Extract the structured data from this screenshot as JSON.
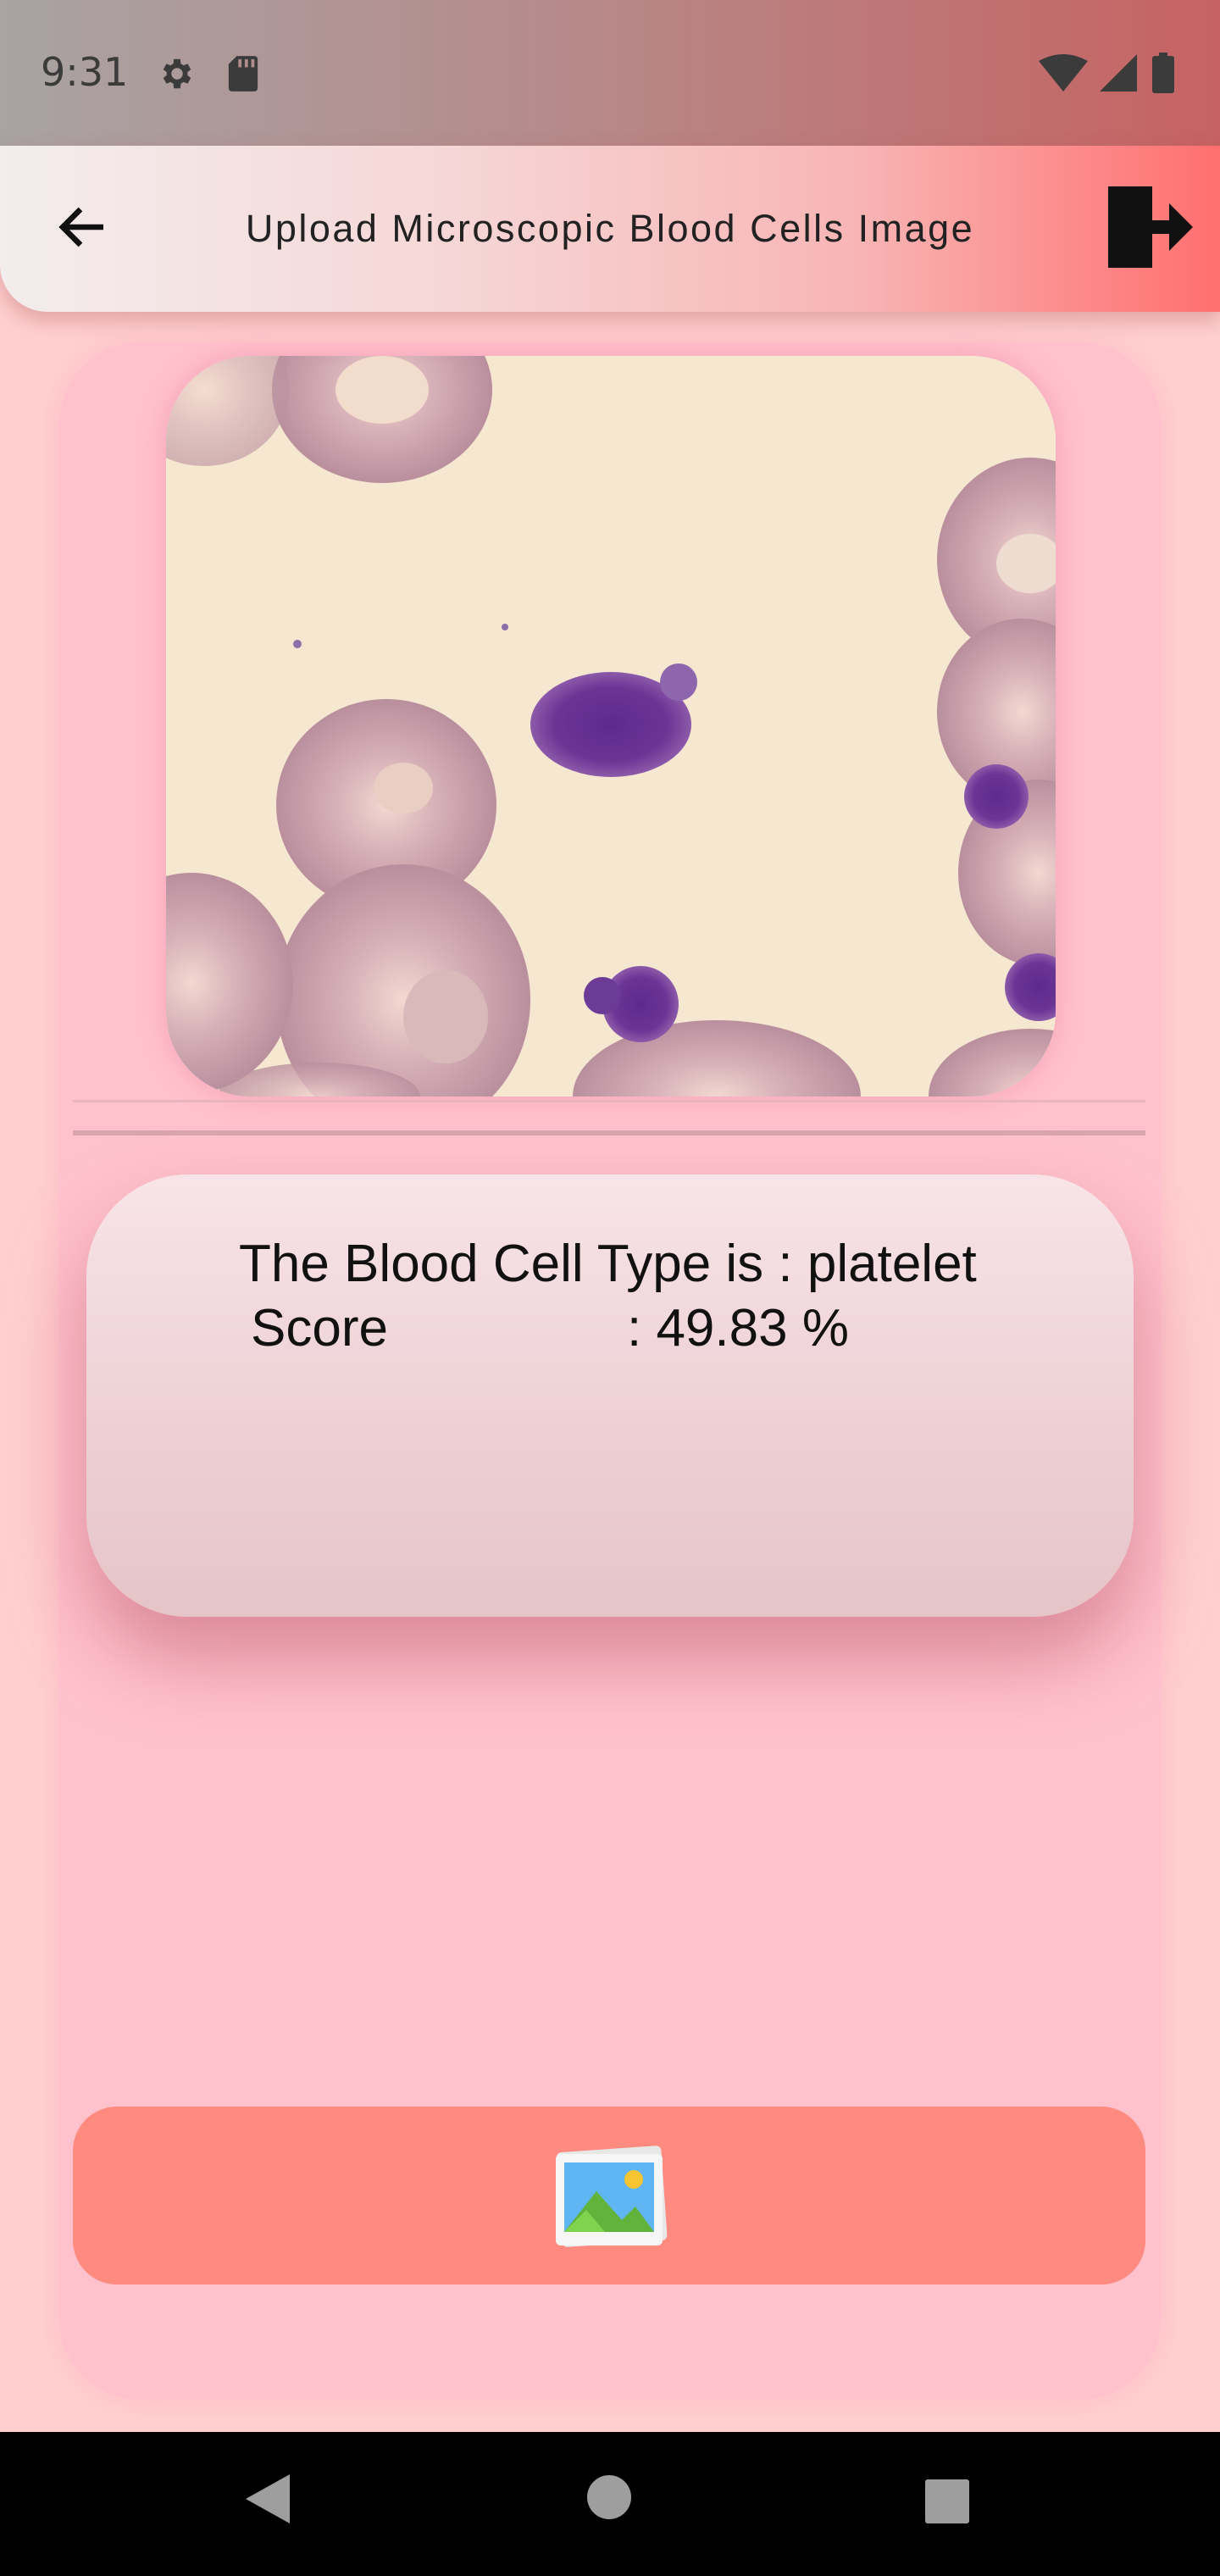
{
  "status_bar": {
    "time": "9:31",
    "icons": [
      "gear-icon",
      "sd-card-icon",
      "wifi-icon",
      "cell-signal-icon",
      "battery-icon"
    ]
  },
  "app_bar": {
    "title": "Upload Microscopic Blood Cells Image",
    "back_icon": "arrow-left-icon",
    "logout_icon": "logout-icon"
  },
  "result": {
    "type_line": "The Blood Cell Type is : platelet",
    "score_label": "Score",
    "score_value": ": 49.83 %"
  },
  "pick_button": {
    "icon": "gallery-image-icon"
  },
  "nav_bar": {
    "icons": [
      "nav-back-icon",
      "nav-home-icon",
      "nav-recents-icon"
    ]
  },
  "colors": {
    "background": "#ffcfcf",
    "card": "#ffc2cc",
    "button": "#ff8a80",
    "appbar_accent": "#ff6f6f"
  }
}
